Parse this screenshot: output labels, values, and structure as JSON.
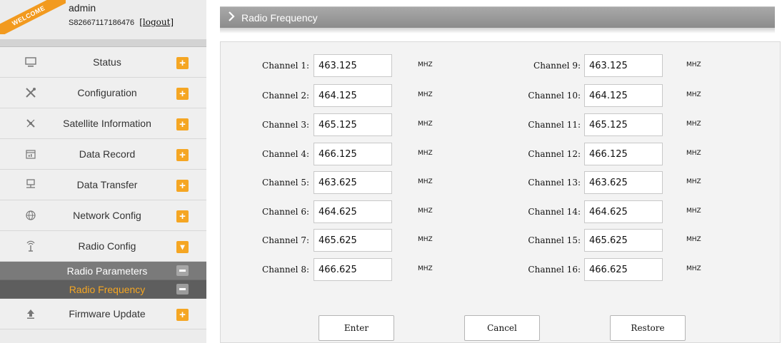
{
  "welcome": "WELCOME",
  "user": {
    "name": "admin",
    "serial": "S82667117186476",
    "logout_label": "[logout]"
  },
  "sidebar": {
    "items": [
      {
        "label": "Status",
        "icon": "monitor-icon",
        "expander": "+"
      },
      {
        "label": "Configuration",
        "icon": "tools-icon",
        "expander": "+"
      },
      {
        "label": "Satellite Information",
        "icon": "satellite-icon",
        "expander": "+"
      },
      {
        "label": "Data Record",
        "icon": "calendar-icon",
        "expander": "+"
      },
      {
        "label": "Data Transfer",
        "icon": "network-icon",
        "expander": "+"
      },
      {
        "label": "Network Config",
        "icon": "globe-icon",
        "expander": "+"
      },
      {
        "label": "Radio Config",
        "icon": "antenna-icon",
        "expander": "▾"
      }
    ],
    "subitems": [
      {
        "label": "Radio Parameters",
        "active": false
      },
      {
        "label": "Radio Frequency",
        "active": true
      }
    ],
    "after": [
      {
        "label": "Firmware Update",
        "icon": "upload-icon",
        "expander": "+"
      }
    ]
  },
  "page": {
    "title": "Radio Frequency"
  },
  "channels": {
    "unit": "MHZ",
    "left": [
      {
        "label": "Channel 1:",
        "value": "463.125"
      },
      {
        "label": "Channel 2:",
        "value": "464.125"
      },
      {
        "label": "Channel 3:",
        "value": "465.125"
      },
      {
        "label": "Channel 4:",
        "value": "466.125"
      },
      {
        "label": "Channel 5:",
        "value": "463.625"
      },
      {
        "label": "Channel 6:",
        "value": "464.625"
      },
      {
        "label": "Channel 7:",
        "value": "465.625"
      },
      {
        "label": "Channel 8:",
        "value": "466.625"
      }
    ],
    "right": [
      {
        "label": "Channel 9:",
        "value": "463.125"
      },
      {
        "label": "Channel 10:",
        "value": "464.125"
      },
      {
        "label": "Channel 11:",
        "value": "465.125"
      },
      {
        "label": "Channel 12:",
        "value": "466.125"
      },
      {
        "label": "Channel 13:",
        "value": "463.625"
      },
      {
        "label": "Channel 14:",
        "value": "464.625"
      },
      {
        "label": "Channel 15:",
        "value": "465.625"
      },
      {
        "label": "Channel 16:",
        "value": "466.625"
      }
    ]
  },
  "buttons": {
    "enter": "Enter",
    "cancel": "Cancel",
    "restore": "Restore"
  },
  "colors": {
    "accent": "#f5a623",
    "submenu": "#7a7a7a",
    "submenu_active": "#5e5e5e"
  }
}
